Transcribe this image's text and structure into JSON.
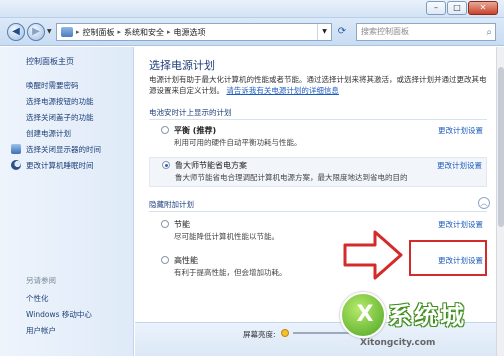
{
  "window": {
    "minimize_label": "–",
    "maximize_label": "□",
    "close_label": "✕"
  },
  "address_bar": {
    "breadcrumbs": [
      "控制面板",
      "系统和安全",
      "电源选项"
    ],
    "separator": "▸",
    "search_placeholder": "搜索控制面板"
  },
  "sidebar": {
    "title": "控制面板主页",
    "links": [
      {
        "label": "唤醒时需要密码",
        "icon": null
      },
      {
        "label": "选择电源按钮的功能",
        "icon": null
      },
      {
        "label": "选择关闭盖子的功能",
        "icon": null
      },
      {
        "label": "创建电源计划",
        "icon": null
      },
      {
        "label": "选择关闭显示器的时间",
        "icon": "monitor-icon"
      },
      {
        "label": "更改计算机睡眠时间",
        "icon": "moon-icon"
      }
    ],
    "see_also_title": "另请参阅",
    "see_also": [
      "个性化",
      "Windows 移动中心",
      "用户帐户"
    ]
  },
  "main": {
    "title": "选择电源计划",
    "description": "电源计划有助于最大化计算机的性能或者节能。通过选择计划来将其激活，或选择计划并通过更改其电源设置来自定义计划。",
    "description_link": "请告诉我有关电源计划的详细信息",
    "battery_section_title": "电池安时计上显示的计划",
    "plans_primary": [
      {
        "name": "平衡 (推荐)",
        "desc": "利用可用的硬件自动平衡功耗与性能。",
        "link": "更改计划设置",
        "selected": false
      },
      {
        "name": "鲁大师节能省电方案",
        "desc": "鲁大师节能省电合理调配计算机电源方案，最大限度地达到省电的目的",
        "link": "更改计划设置",
        "selected": true
      }
    ],
    "hidden_section_title": "隐藏附加计划",
    "plans_hidden": [
      {
        "name": "节能",
        "desc": "尽可能降低计算机性能以节能。",
        "link": "更改计划设置",
        "selected": false
      },
      {
        "name": "高性能",
        "desc": "有利于提高性能，但会增加功耗。",
        "link": "更改计划设置",
        "selected": false
      }
    ],
    "brightness_label": "屏幕亮度:"
  },
  "watermark": {
    "text": "系统城",
    "url": "Xitongcity.com"
  },
  "colors": {
    "link": "#1d5bbf",
    "highlight": "#d42a2a",
    "accent_green": "#4da523"
  }
}
